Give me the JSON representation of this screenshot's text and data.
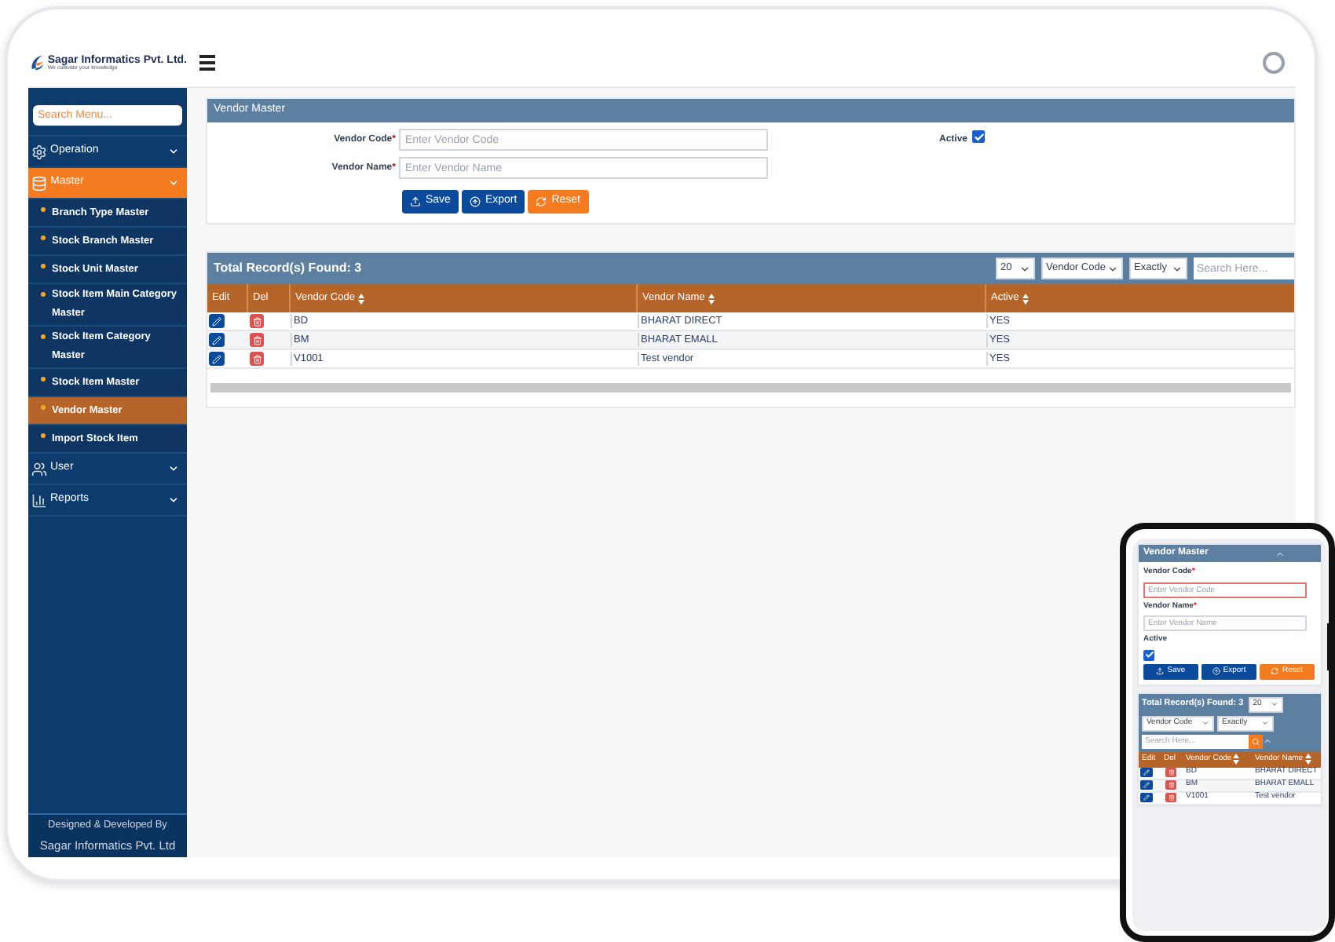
{
  "app": {
    "brand": "Sagar Informatics Pvt. Ltd.",
    "tagline": "We cultivate your knowledge"
  },
  "sidebar": {
    "search_placeholder": "Search Menu...",
    "items": [
      {
        "label": "Operation",
        "kind": "gear",
        "expanded": false
      },
      {
        "label": "Master",
        "kind": "database",
        "expanded": true,
        "children": [
          {
            "label": "Branch Type Master",
            "selected": false
          },
          {
            "label": "Stock Branch Master",
            "selected": false
          },
          {
            "label": "Stock Unit Master",
            "selected": false
          },
          {
            "label": "Stock Item Main Category Master",
            "selected": false
          },
          {
            "label": "Stock Item Category Master",
            "selected": false
          },
          {
            "label": "Stock Item Master",
            "selected": false
          },
          {
            "label": "Vendor Master",
            "selected": true
          },
          {
            "label": "Import Stock Item",
            "selected": false
          }
        ]
      },
      {
        "label": "User",
        "kind": "users",
        "expanded": false
      },
      {
        "label": "Reports",
        "kind": "chart",
        "expanded": false
      }
    ],
    "footer": [
      "Designed & Developed By",
      "Sagar Informatics Pvt. Ltd"
    ]
  },
  "form": {
    "title": "Vendor Master",
    "fields": [
      {
        "label": "Vendor Code",
        "marker": "*",
        "placeholder": "Enter Vendor Code"
      },
      {
        "label": "Vendor Name",
        "marker": "*",
        "placeholder": "Enter Vendor Name"
      }
    ],
    "active": {
      "label": "Active",
      "checked": true
    },
    "buttons": [
      {
        "label": "Save",
        "kind": "save"
      },
      {
        "label": "Export",
        "kind": "export"
      },
      {
        "label": "Reset",
        "kind": "reset"
      }
    ]
  },
  "table": {
    "title": "Total Record(s) Found: 3",
    "page_size": "20",
    "search_by": "Vendor Code",
    "match": "Exactly",
    "search_placeholder": "Search Here...",
    "columns": [
      {
        "label": "Edit",
        "kind": "edit",
        "sortable": false
      },
      {
        "label": "Del",
        "kind": "delete",
        "sortable": false
      },
      {
        "label": "Vendor Code",
        "kind": "text",
        "sortable": true
      },
      {
        "label": "Vendor Name",
        "kind": "text",
        "sortable": true
      },
      {
        "label": "Active",
        "kind": "text",
        "sortable": true
      }
    ],
    "rows": [
      [
        "",
        "",
        "BD",
        "BHARAT DIRECT",
        "YES"
      ],
      [
        "",
        "",
        "BM",
        "BHARAT EMALL",
        "YES"
      ],
      [
        "",
        "",
        "V1001",
        "Test vendor",
        "YES"
      ]
    ]
  },
  "phone": {
    "title": "Vendor Master",
    "fields": [
      {
        "label": "Vendor Code",
        "marker": "*",
        "placeholder": "Enter Vendor Code",
        "invalid": true
      },
      {
        "label": "Vendor Name",
        "marker": "*",
        "placeholder": "Enter Vendor Name",
        "invalid": false
      }
    ],
    "active": {
      "label": "Active",
      "checked": true
    },
    "buttons": [
      {
        "label": "Save",
        "kind": "save"
      },
      {
        "label": "Export",
        "kind": "export"
      },
      {
        "label": "Reset",
        "kind": "reset"
      }
    ],
    "table_title": "Total Record(s) Found: 3",
    "page_size": "20",
    "search_by": "Vendor Code",
    "match": "Exactly",
    "search_placeholder": "Search Here...",
    "columns": [
      {
        "label": "Edit",
        "kind": "edit",
        "sortable": false
      },
      {
        "label": "Del",
        "kind": "delete",
        "sortable": false
      },
      {
        "label": "Vendor Code",
        "kind": "text",
        "sortable": true
      },
      {
        "label": "Vendor Name",
        "kind": "text",
        "sortable": true
      }
    ],
    "rows": [
      [
        "",
        "",
        "BD",
        "BHARAT DIRECT"
      ],
      [
        "",
        "",
        "BM",
        "BHARAT EMALL"
      ],
      [
        "",
        "",
        "V1001",
        "Test vendor"
      ]
    ]
  }
}
